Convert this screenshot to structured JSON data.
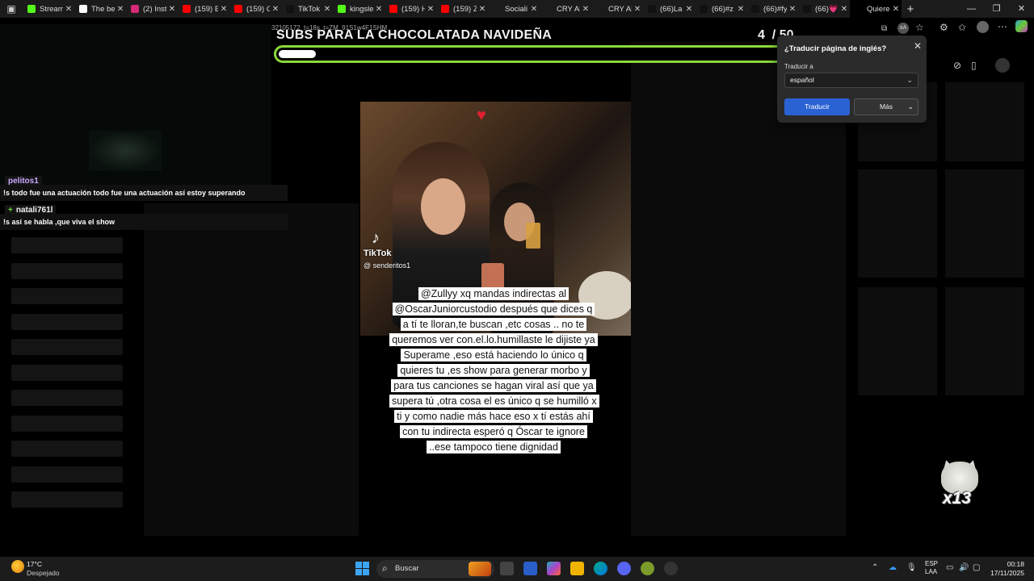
{
  "browser": {
    "tabs": [
      {
        "title": "Stream",
        "favicon": "kick-icon",
        "color": "#53fc18"
      },
      {
        "title": "The be",
        "favicon": "diamond-icon",
        "color": "#ffffff"
      },
      {
        "title": "(2) Inst",
        "favicon": "instagram-icon",
        "color": "#d62976"
      },
      {
        "title": "(159) E",
        "favicon": "youtube-icon",
        "color": "#ff0000"
      },
      {
        "title": "(159) C",
        "favicon": "youtube-icon",
        "color": "#ff0000"
      },
      {
        "title": "TikTok",
        "favicon": "tiktok-icon",
        "color": "#111111"
      },
      {
        "title": "kingsle",
        "favicon": "kick-icon",
        "color": "#53fc18"
      },
      {
        "title": "(159) H",
        "favicon": "youtube-icon",
        "color": "#ff0000"
      },
      {
        "title": "(159) Z",
        "favicon": "youtube-icon",
        "color": "#ff0000"
      },
      {
        "title": "Sociali",
        "favicon": "blank-icon",
        "color": "#1b1b1b"
      },
      {
        "title": "CRY AF",
        "favicon": "search-icon",
        "color": "#1b1b1b"
      },
      {
        "title": "CRY AF",
        "favicon": "search-icon",
        "color": "#1b1b1b"
      },
      {
        "title": "(66)La",
        "favicon": "tiktok-icon",
        "color": "#111111"
      },
      {
        "title": "(66)#z",
        "favicon": "tiktok-icon",
        "color": "#111111"
      },
      {
        "title": "(66)#fy",
        "favicon": "tiktok-icon",
        "color": "#111111"
      },
      {
        "title": "(66)💗",
        "favicon": "tiktok-icon",
        "color": "#111111"
      },
      {
        "title": "Quiere",
        "favicon": "loading-icon",
        "color": "#000000",
        "active": true
      }
    ],
    "new_tab": "+",
    "url_fragment": "32105172_t=18s_t=ZM_91S1w4F1SHM"
  },
  "stream": {
    "goal_title": "SUBS PARA LA CHOCOLATADA NAVIDEÑA",
    "goal_current": "4",
    "goal_total": "/ 50",
    "goal_progress": 0.08,
    "accent": "#8bd93a"
  },
  "chat": {
    "messages": [
      {
        "user": "pelitos1",
        "user_color": "#c9a8ff",
        "text": "!s todo fue una actuación todo fue una actuación así estoy superando"
      },
      {
        "user": "natali761l",
        "user_color": "#f2f2f2",
        "badge": "+",
        "badge_color": "#6ddc3a",
        "text": "!s así se habla ,que viva el show"
      }
    ]
  },
  "video": {
    "watermark": "TikTok",
    "watermark_user": "@ senderitos1",
    "caption": "@Zullyy  xq mandas indirectas al @OscarJuniorcustodio  después que dices q a tí te lloran,te buscan ,etc cosas .. no te queremos ver con.el.lo.humillaste le dijiste ya Superame ,eso está haciendo lo único q quieres tu ,es show para generar morbo y para tus canciones se hagan viral así que ya supera tú ,otra cosa el es único q se humilló x ti y como nadie más hace eso x tí estás ahí con tu indirecta esperó q Óscar te ignore ..ese tampoco tiene dignidad"
  },
  "translate_popup": {
    "title": "¿Traducir página de inglés?",
    "label": "Traducir a",
    "language": "español",
    "translate_button": "Traducir",
    "more_button": "Más",
    "primary_color": "#2a62d4"
  },
  "emote_counter": "x13",
  "taskbar": {
    "temperature": "17°C",
    "weather": "Despejado",
    "search_placeholder": "Buscar",
    "lang_top": "ESP",
    "lang_bottom": "LAA",
    "time": "00:18",
    "date": "17/11/2025"
  }
}
